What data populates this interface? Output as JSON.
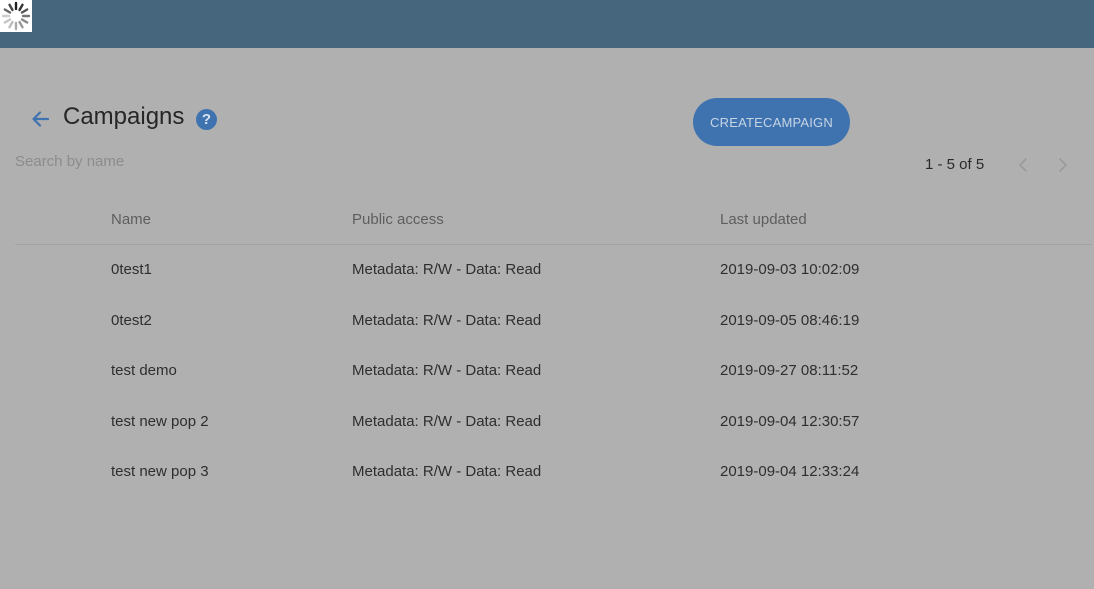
{
  "header": {
    "background": "#45667d"
  },
  "loading_indicator": {
    "icon": "spinner-icon"
  },
  "page": {
    "title": "Campaigns",
    "back_icon": "arrow-left-icon",
    "help_icon": "question-mark-icon",
    "help_glyph": "?"
  },
  "toolbar": {
    "create_label": "CREATECAMPAIGN",
    "accent_color": "#3f73b0"
  },
  "search": {
    "placeholder": "Search by name",
    "value": ""
  },
  "pagination": {
    "range_text": "1 - 5 of 5",
    "prev_icon": "chevron-left-icon",
    "next_icon": "chevron-right-icon"
  },
  "table": {
    "columns": [
      "Name",
      "Public access",
      "Last updated"
    ],
    "rows": [
      {
        "name": "0test1",
        "public_access": "Metadata: R/W - Data: Read",
        "last_updated": "2019-09-03 10:02:09"
      },
      {
        "name": "0test2",
        "public_access": "Metadata: R/W - Data: Read",
        "last_updated": "2019-09-05 08:46:19"
      },
      {
        "name": "test demo",
        "public_access": "Metadata: R/W - Data: Read",
        "last_updated": "2019-09-27 08:11:52"
      },
      {
        "name": "test new pop 2",
        "public_access": "Metadata: R/W - Data: Read",
        "last_updated": "2019-09-04 12:30:57"
      },
      {
        "name": "test new pop 3",
        "public_access": "Metadata: R/W - Data: Read",
        "last_updated": "2019-09-04 12:33:24"
      }
    ]
  }
}
